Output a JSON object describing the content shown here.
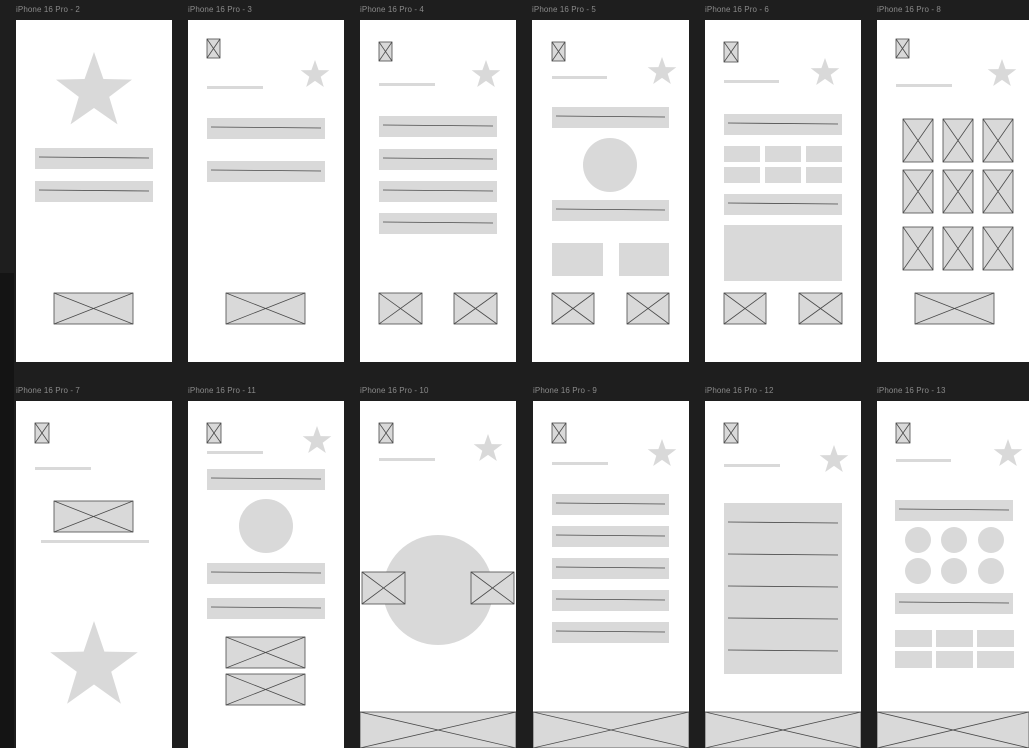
{
  "canvas": {
    "background": "#1e1e1e",
    "frame_color": "#ffffff",
    "placeholder_fill": "#d9d9d9",
    "placeholder_stroke": "#4a4a4a"
  },
  "frames": [
    {
      "id": "f2",
      "label": "iPhone 16 Pro - 2"
    },
    {
      "id": "f3",
      "label": "iPhone 16 Pro - 3"
    },
    {
      "id": "f4",
      "label": "iPhone 16 Pro - 4"
    },
    {
      "id": "f5",
      "label": "iPhone 16 Pro - 5"
    },
    {
      "id": "f6",
      "label": "iPhone 16 Pro - 6"
    },
    {
      "id": "f8",
      "label": "iPhone 16 Pro - 8"
    },
    {
      "id": "f7",
      "label": "iPhone 16 Pro - 7"
    },
    {
      "id": "f11",
      "label": "iPhone 16 Pro - 11"
    },
    {
      "id": "f10",
      "label": "iPhone 16 Pro - 10"
    },
    {
      "id": "f9",
      "label": "iPhone 16 Pro - 9"
    },
    {
      "id": "f12",
      "label": "iPhone 16 Pro - 12"
    },
    {
      "id": "f13",
      "label": "iPhone 16 Pro - 13"
    }
  ]
}
